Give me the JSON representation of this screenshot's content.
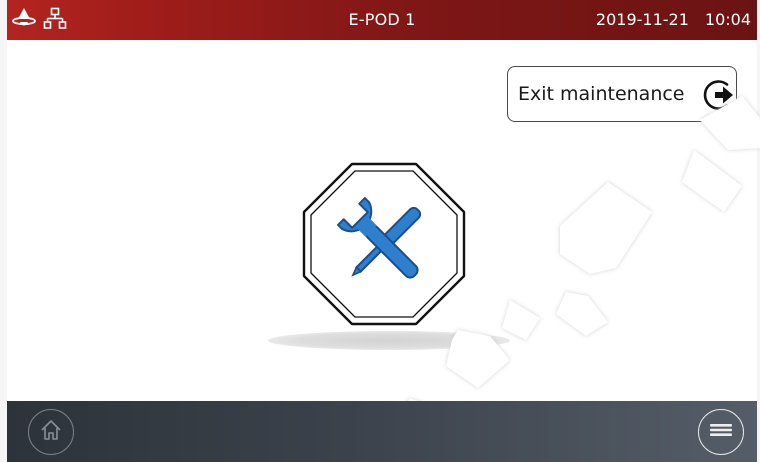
{
  "topbar": {
    "title": "E-POD 1",
    "date": "2019-11-21",
    "time": "10:04",
    "left_icons": [
      "device-alert-icon",
      "network-icon"
    ]
  },
  "main": {
    "exit_button": {
      "label": "Exit maintenance",
      "icon": "exit-arrow-icon"
    },
    "emblem_icon": "wrench-screwdriver-icon"
  },
  "bottombar": {
    "home_icon": "home-icon",
    "menu_icon": "menu-icon"
  },
  "colors": {
    "topbar_accent": "#a01d1a",
    "tool_blue": "#2f7fcf",
    "bottombar": "#3b424b"
  }
}
